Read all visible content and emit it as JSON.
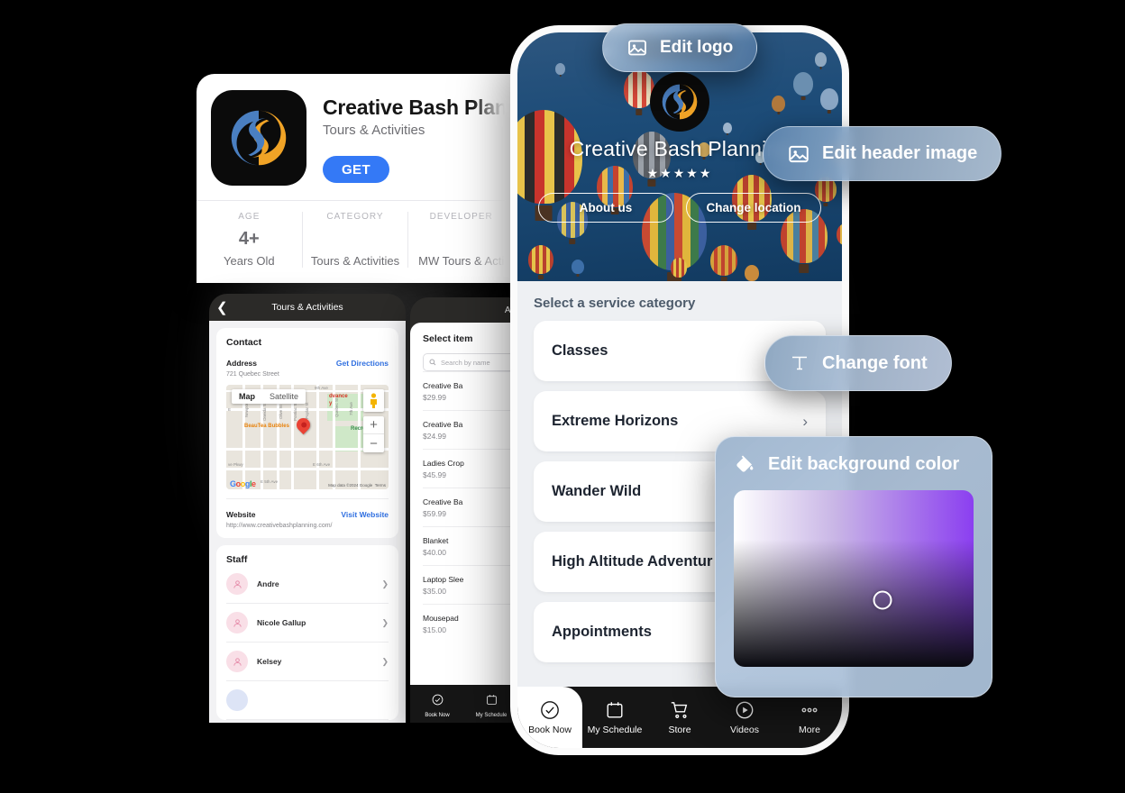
{
  "appstore": {
    "app_name": "Creative Bash Planning",
    "subtitle": "Tours & Activities",
    "get_label": "GET",
    "stats": [
      {
        "label": "AGE",
        "value": "4+",
        "note": "Years Old"
      },
      {
        "label": "CATEGORY",
        "value": "",
        "note": "Tours & Activities"
      },
      {
        "label": "DEVELOPER",
        "value": "",
        "note": "MW Tours & Acti"
      }
    ]
  },
  "left_phone": {
    "nav_title": "Tours & Activities",
    "back_icon": "chevron-left-icon",
    "contact_heading": "Contact",
    "address_label": "Address",
    "directions_link": "Get Directions",
    "address_value": "721 Quebec Street",
    "map": {
      "tab_map": "Map",
      "tab_satellite": "Satellite",
      "poi_beautea": "BeauTea Bubbles",
      "poi_recreation": "Recreati",
      "poi_advance": "dvance",
      "poi_advance2": "y",
      "streets": [
        "Newport St",
        "Oneida St",
        "Olive St",
        "Pontiac St",
        "Poplar St",
        "Quebec St",
        "7th Ave",
        "E 6th Ave",
        "E 5th Ave",
        "ve Pkwy",
        "9th Ave",
        "E"
      ],
      "logo_text": "Google",
      "attribution": "Map data ©2024 Google",
      "terms": "Terms",
      "zoom_in": "+",
      "zoom_out": "−"
    },
    "website_label": "Website",
    "website_link": "Visit Website",
    "website_url": "http://www.creativebashplanning.com/",
    "staff_heading": "Staff",
    "staff": [
      {
        "name": "Andre"
      },
      {
        "name": "Nicole Gallup"
      },
      {
        "name": "Kelsey"
      }
    ]
  },
  "mid_phone": {
    "nav_title": "All",
    "heading": "Select item",
    "search_placeholder": "Search by name",
    "items": [
      {
        "name": "Creative Ba",
        "price": "$29.99"
      },
      {
        "name": "Creative Ba",
        "price": "$24.99"
      },
      {
        "name": "Ladies Crop",
        "price": "$45.99"
      },
      {
        "name": "Creative Ba",
        "price": "$59.99"
      },
      {
        "name": "Blanket",
        "price": "$40.00"
      },
      {
        "name": "Laptop Slee",
        "price": "$35.00"
      },
      {
        "name": "Mousepad",
        "price": "$15.00"
      }
    ],
    "tabs": [
      {
        "label": "Book Now",
        "icon": "check-circle-icon"
      },
      {
        "label": "My Schedule",
        "icon": "calendar-icon"
      }
    ]
  },
  "main_phone": {
    "header": {
      "business_name": "Creative Bash Planning",
      "rating_stars": "★★★★★",
      "rating_count": 5,
      "about_button": "About us",
      "location_button": "Change location",
      "logo_icon": "app-logo-icon",
      "background_image": "hot-air-balloons-photo"
    },
    "section_title": "Select a service category",
    "categories": [
      {
        "name": "Classes"
      },
      {
        "name": "Extreme Horizons"
      },
      {
        "name": "Wander Wild"
      },
      {
        "name": "High Altitude Adventur"
      },
      {
        "name": "Appointments"
      }
    ],
    "tabs": [
      {
        "label": "Book Now",
        "icon": "check-circle-icon",
        "active": true
      },
      {
        "label": "My Schedule",
        "icon": "calendar-icon",
        "active": false
      },
      {
        "label": "Store",
        "icon": "shopping-cart-icon",
        "active": false
      },
      {
        "label": "Videos",
        "icon": "play-circle-icon",
        "active": false
      },
      {
        "label": "More",
        "icon": "ellipsis-icon",
        "active": false
      }
    ]
  },
  "edit_controls": {
    "edit_logo": {
      "label": "Edit logo",
      "icon": "image-icon"
    },
    "edit_header": {
      "label": "Edit header image",
      "icon": "image-icon"
    },
    "change_font": {
      "label": "Change font",
      "icon": "text-format-icon"
    },
    "edit_background": {
      "label": "Edit background color",
      "icon": "paint-bucket-icon"
    }
  },
  "colors": {
    "accent_blue": "#3479f6",
    "link_blue": "#2f6fe0",
    "page_bg": "#000000",
    "content_bg": "#eef0f3",
    "tabbar_bg": "#151515",
    "pill_blue": "#9eb5ce",
    "swatch_purple": "#8b3ff0"
  }
}
